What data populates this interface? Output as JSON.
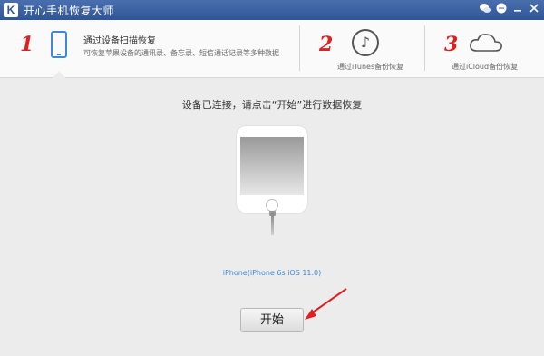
{
  "app": {
    "logo_letter": "K",
    "title": "开心手机恢复大师"
  },
  "window_controls": {
    "wechat_icon": "wechat-icon",
    "chat_icon": "chat-icon",
    "minimize_icon": "minimize-icon",
    "close_icon": "close-icon"
  },
  "steps": {
    "step1": {
      "number": "1",
      "title": "通过设备扫描恢复",
      "description": "可恢复苹果设备的通讯录、备忘录、短信通话记录等多种数据",
      "icon": "phone-icon"
    },
    "step2": {
      "number": "2",
      "label": "通过iTunes备份恢复",
      "icon": "music-note-icon"
    },
    "step3": {
      "number": "3",
      "label": "通过iCloud备份恢复",
      "icon": "cloud-icon"
    }
  },
  "main": {
    "status_text": "设备已连接，请点击“开始”进行数据恢复",
    "device_info": "iPhone(iPhone 6s iOS 11.0)",
    "start_button": "开始"
  },
  "colors": {
    "titlebar": "#2f5597",
    "accent_blue": "#3d88d8",
    "step_number_red": "#e02020",
    "annotation_arrow": "#e02020"
  }
}
